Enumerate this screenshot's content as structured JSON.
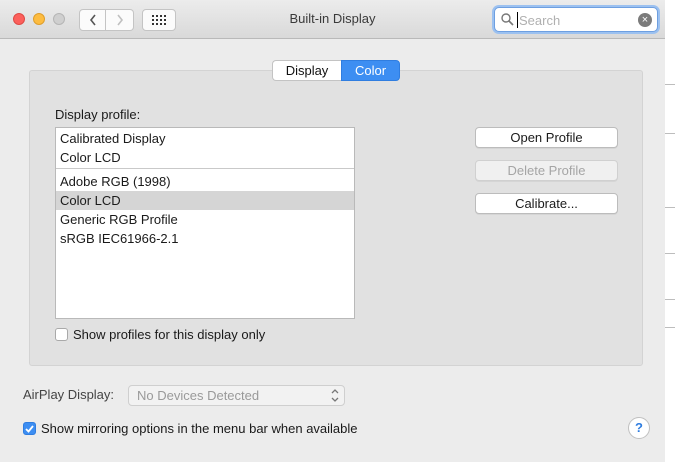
{
  "window": {
    "title": "Built-in Display"
  },
  "search": {
    "placeholder": "Search"
  },
  "tabs": [
    {
      "label": "Display"
    },
    {
      "label": "Color"
    }
  ],
  "selected_tab": "Color",
  "profile": {
    "label": "Display profile:",
    "items": [
      {
        "label": "Calibrated Display"
      },
      {
        "label": "Color LCD"
      },
      {
        "label": "Adobe RGB (1998)"
      },
      {
        "label": "Color LCD"
      },
      {
        "label": "Generic RGB Profile"
      },
      {
        "label": "sRGB IEC61966-2.1"
      }
    ],
    "selected": "Color LCD"
  },
  "buttons": {
    "open_profile": "Open Profile",
    "delete_profile": "Delete Profile",
    "calibrate": "Calibrate..."
  },
  "show_profiles_only": {
    "label": "Show profiles for this display only",
    "checked": false
  },
  "airplay": {
    "label": "AirPlay Display:",
    "value": "No Devices Detected"
  },
  "mirroring": {
    "label": "Show mirroring options in the menu bar when available",
    "checked": true
  },
  "help": {
    "label": "?"
  },
  "colors": {
    "accent": "#3d8ef2",
    "close": "#fc605c",
    "minimize": "#fdbc40"
  }
}
